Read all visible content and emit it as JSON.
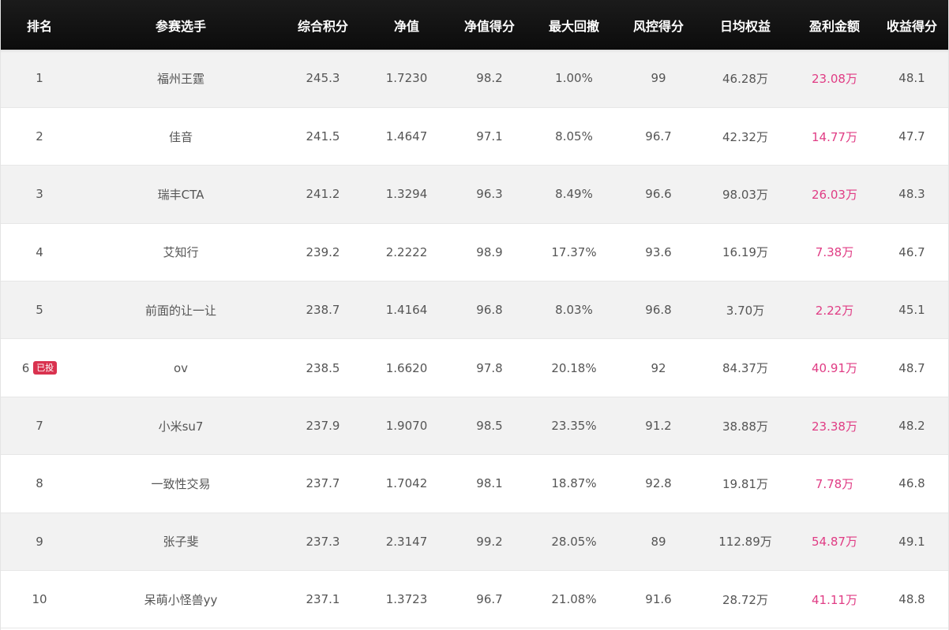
{
  "headers": {
    "rank": "排名",
    "player": "参赛选手",
    "total_score": "综合积分",
    "nav": "净值",
    "nav_score": "净值得分",
    "max_drawdown": "最大回撤",
    "risk_score": "风控得分",
    "daily_equity": "日均权益",
    "profit": "盈利金额",
    "return_score": "收益得分"
  },
  "colors": {
    "header_bg": "#111111",
    "row_alt_bg": "#f2f2f2",
    "profit_text": "#e03c84",
    "badge_bg": "#d9324f"
  },
  "rows": [
    {
      "rank": "1",
      "badge": "",
      "player": "福州王霆",
      "total_score": "245.3",
      "nav": "1.7230",
      "nav_score": "98.2",
      "max_drawdown": "1.00%",
      "risk_score": "99",
      "daily_equity": "46.28万",
      "profit": "23.08万",
      "return_score": "48.1"
    },
    {
      "rank": "2",
      "badge": "",
      "player": "佳音",
      "total_score": "241.5",
      "nav": "1.4647",
      "nav_score": "97.1",
      "max_drawdown": "8.05%",
      "risk_score": "96.7",
      "daily_equity": "42.32万",
      "profit": "14.77万",
      "return_score": "47.7"
    },
    {
      "rank": "3",
      "badge": "",
      "player": "瑞丰CTA",
      "total_score": "241.2",
      "nav": "1.3294",
      "nav_score": "96.3",
      "max_drawdown": "8.49%",
      "risk_score": "96.6",
      "daily_equity": "98.03万",
      "profit": "26.03万",
      "return_score": "48.3"
    },
    {
      "rank": "4",
      "badge": "",
      "player": "艾知行",
      "total_score": "239.2",
      "nav": "2.2222",
      "nav_score": "98.9",
      "max_drawdown": "17.37%",
      "risk_score": "93.6",
      "daily_equity": "16.19万",
      "profit": "7.38万",
      "return_score": "46.7"
    },
    {
      "rank": "5",
      "badge": "",
      "player": "前面的让一让",
      "total_score": "238.7",
      "nav": "1.4164",
      "nav_score": "96.8",
      "max_drawdown": "8.03%",
      "risk_score": "96.8",
      "daily_equity": "3.70万",
      "profit": "2.22万",
      "return_score": "45.1"
    },
    {
      "rank": "6",
      "badge": "已投",
      "player": "ov",
      "total_score": "238.5",
      "nav": "1.6620",
      "nav_score": "97.8",
      "max_drawdown": "20.18%",
      "risk_score": "92",
      "daily_equity": "84.37万",
      "profit": "40.91万",
      "return_score": "48.7"
    },
    {
      "rank": "7",
      "badge": "",
      "player": "小米su7",
      "total_score": "237.9",
      "nav": "1.9070",
      "nav_score": "98.5",
      "max_drawdown": "23.35%",
      "risk_score": "91.2",
      "daily_equity": "38.88万",
      "profit": "23.38万",
      "return_score": "48.2"
    },
    {
      "rank": "8",
      "badge": "",
      "player": "一致性交易",
      "total_score": "237.7",
      "nav": "1.7042",
      "nav_score": "98.1",
      "max_drawdown": "18.87%",
      "risk_score": "92.8",
      "daily_equity": "19.81万",
      "profit": "7.78万",
      "return_score": "46.8"
    },
    {
      "rank": "9",
      "badge": "",
      "player": "张子斐",
      "total_score": "237.3",
      "nav": "2.3147",
      "nav_score": "99.2",
      "max_drawdown": "28.05%",
      "risk_score": "89",
      "daily_equity": "112.89万",
      "profit": "54.87万",
      "return_score": "49.1"
    },
    {
      "rank": "10",
      "badge": "",
      "player": "呆萌小怪兽yy",
      "total_score": "237.1",
      "nav": "1.3723",
      "nav_score": "96.7",
      "max_drawdown": "21.08%",
      "risk_score": "91.6",
      "daily_equity": "28.72万",
      "profit": "41.11万",
      "return_score": "48.8"
    }
  ]
}
